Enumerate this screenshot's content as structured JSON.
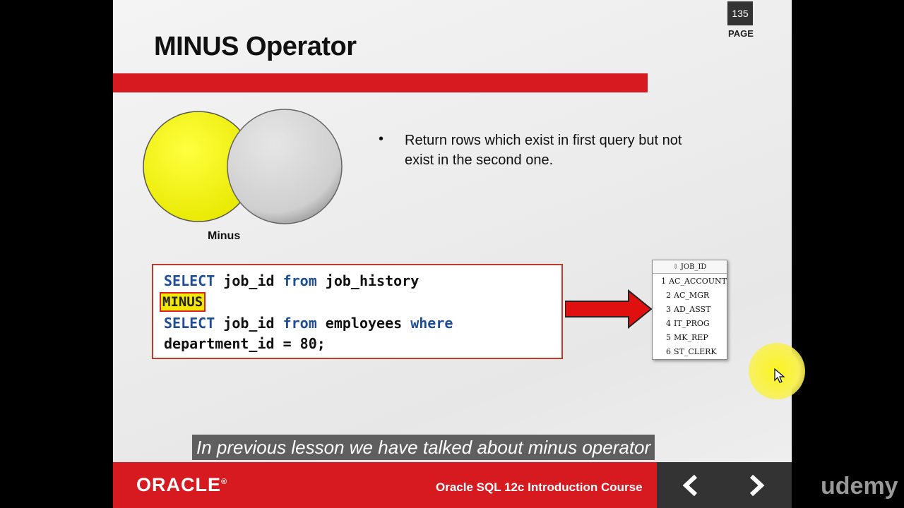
{
  "page": {
    "number": "135",
    "label": "PAGE"
  },
  "slide": {
    "title": "MINUS Operator",
    "venn_label": "Minus",
    "bullet_symbol": "•",
    "bullet_text": "Return rows which exist in first query but not exist in the second one."
  },
  "code": {
    "line1": {
      "kw1": "SELECT",
      "t1": " job_id ",
      "kw2": "from",
      "t2": " job_history"
    },
    "minus": "MINUS",
    "line3": {
      "kw1": "SELECT",
      "t1": " job_id ",
      "kw2": "from",
      "t2": " employees ",
      "kw3": "where"
    },
    "line4": "department_id = 80;"
  },
  "result": {
    "header": "JOB_ID",
    "rows": [
      {
        "n": "1",
        "v": "AC_ACCOUNT"
      },
      {
        "n": "2",
        "v": "AC_MGR"
      },
      {
        "n": "3",
        "v": "AD_ASST"
      },
      {
        "n": "4",
        "v": "IT_PROG"
      },
      {
        "n": "5",
        "v": "MK_REP"
      },
      {
        "n": "6",
        "v": "ST_CLERK"
      }
    ]
  },
  "footer": {
    "logo": "ORACLE",
    "registered": "®",
    "course": "Oracle SQL 12c Introduction Course"
  },
  "caption": "In previous lesson we have talked about minus operator",
  "watermark": "udemy",
  "colors": {
    "accent_red": "#d71920",
    "keyword_blue": "#1f4e96",
    "highlight_yellow": "#f5e800",
    "venn_left": "#f7f700",
    "venn_right": "#d4d4d4"
  },
  "icons": {
    "prev": "chevron-left-icon",
    "next": "chevron-right-icon",
    "pointer": "mouse-cursor-icon"
  }
}
